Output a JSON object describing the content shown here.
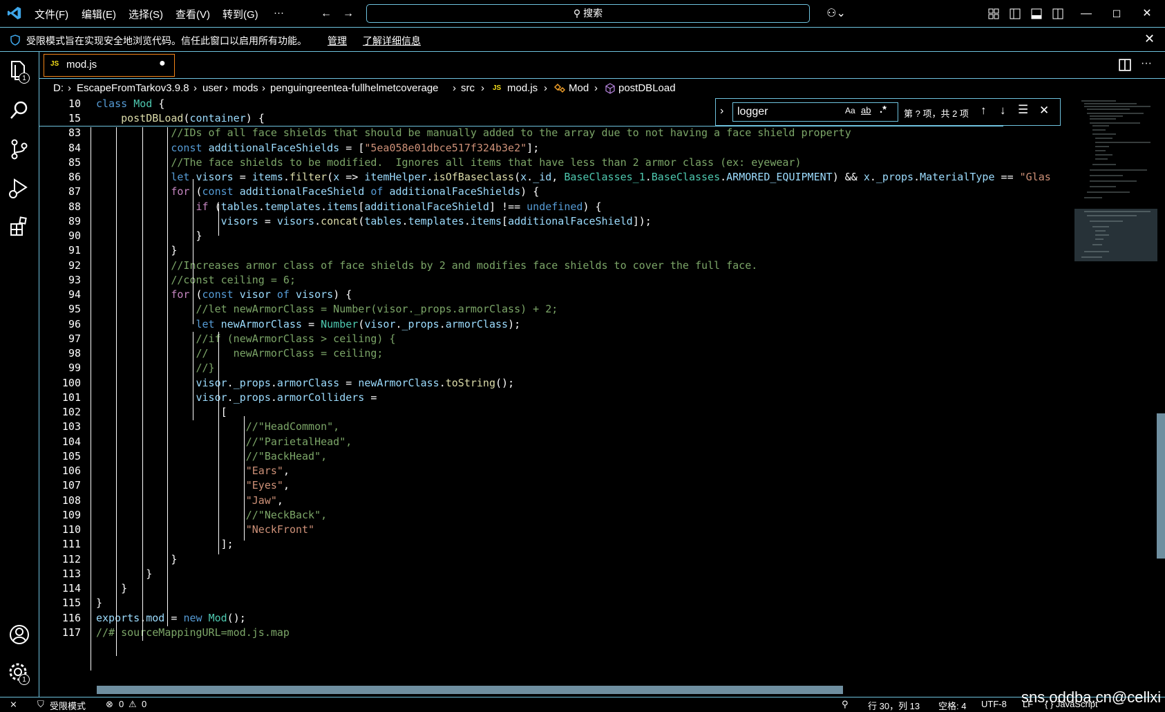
{
  "titlebar": {
    "menus": [
      "文件(F)",
      "编辑(E)",
      "选择(S)",
      "查看(V)",
      "转到(G)",
      "···"
    ],
    "search_label": "搜索"
  },
  "banner": {
    "message": "受限模式旨在实现安全地浏览代码。信任此窗口以启用所有功能。",
    "manage": "管理",
    "learn_more": "了解详细信息"
  },
  "activity": {
    "explorer_badge": "1",
    "settings_badge": "1"
  },
  "tab": {
    "icon_label": "JS",
    "filename": "mod.js"
  },
  "breadcrumb": [
    "D:",
    "EscapeFromTarkov3.9.8",
    "user",
    "mods",
    "penguingreentea-fullhelmetcoverage",
    "src",
    "mod.js",
    "Mod",
    "postDBLoad"
  ],
  "breadcrumb_js": "JS",
  "find": {
    "query": "logger",
    "opt_case": "Aa",
    "opt_word": "ab",
    "opt_regex": ".*",
    "result": "第 ? 项，共 2 项"
  },
  "lines": [
    {
      "n": "10",
      "t": "class Mod {"
    },
    {
      "n": "15",
      "t": "    postDBLoad(container) {"
    },
    {
      "n": "83",
      "t": "            //IDs of all face shields that should be manually added to the array due to not having a face shield property"
    },
    {
      "n": "84",
      "t": "            const additionalFaceShields = [\"5ea058e01dbce517f324b3e2\"];"
    },
    {
      "n": "85",
      "t": "            //The face shields to be modified.  Ignores all items that have less than 2 armor class (ex: eyewear)"
    },
    {
      "n": "86",
      "t": "            let visors = items.filter(x => itemHelper.isOfBaseclass(x._id, BaseClasses_1.BaseClasses.ARMORED_EQUIPMENT) && x._props.MaterialType == \"Glas"
    },
    {
      "n": "87",
      "t": "            for (const additionalFaceShield of additionalFaceShields) {"
    },
    {
      "n": "88",
      "t": "                if (tables.templates.items[additionalFaceShield] !== undefined) {"
    },
    {
      "n": "89",
      "t": "                    visors = visors.concat(tables.templates.items[additionalFaceShield]);"
    },
    {
      "n": "90",
      "t": "                }"
    },
    {
      "n": "91",
      "t": "            }"
    },
    {
      "n": "92",
      "t": "            //Increases armor class of face shields by 2 and modifies face shields to cover the full face."
    },
    {
      "n": "93",
      "t": "            //const ceiling = 6;"
    },
    {
      "n": "94",
      "t": "            for (const visor of visors) {"
    },
    {
      "n": "95",
      "t": "                //let newArmorClass = Number(visor._props.armorClass) + 2;"
    },
    {
      "n": "96",
      "t": "                let newArmorClass = Number(visor._props.armorClass);"
    },
    {
      "n": "97",
      "t": "                //if (newArmorClass > ceiling) {"
    },
    {
      "n": "98",
      "t": "                //    newArmorClass = ceiling;"
    },
    {
      "n": "99",
      "t": "                //}"
    },
    {
      "n": "100",
      "t": "                visor._props.armorClass = newArmorClass.toString();"
    },
    {
      "n": "101",
      "t": "                visor._props.armorColliders ="
    },
    {
      "n": "102",
      "t": "                    ["
    },
    {
      "n": "103",
      "t": "                        //\"HeadCommon\","
    },
    {
      "n": "104",
      "t": "                        //\"ParietalHead\","
    },
    {
      "n": "105",
      "t": "                        //\"BackHead\","
    },
    {
      "n": "106",
      "t": "                        \"Ears\","
    },
    {
      "n": "107",
      "t": "                        \"Eyes\","
    },
    {
      "n": "108",
      "t": "                        \"Jaw\","
    },
    {
      "n": "109",
      "t": "                        //\"NeckBack\","
    },
    {
      "n": "110",
      "t": "                        \"NeckFront\""
    },
    {
      "n": "111",
      "t": "                    ];"
    },
    {
      "n": "112",
      "t": "            }"
    },
    {
      "n": "113",
      "t": "        }"
    },
    {
      "n": "114",
      "t": "    }"
    },
    {
      "n": "115",
      "t": "}"
    },
    {
      "n": "116",
      "t": "exports.mod = new Mod();"
    },
    {
      "n": "117",
      "t": "//# sourceMappingURL=mod.js.map"
    }
  ],
  "status": {
    "remote": "⨯",
    "restricted": "受限模式",
    "errors": "0",
    "warnings": "0",
    "position": "行 30，列 13",
    "spaces": "空格: 4",
    "encoding": "UTF-8",
    "eol": "LF",
    "language": "{ } JavaScript"
  },
  "watermark": "sns.oddba.cn@cellxi",
  "colors": {
    "contrast_border": "#6fc3df",
    "active_border": "#f38518",
    "comment": "#7ca668",
    "keyword": "#569cd6"
  }
}
